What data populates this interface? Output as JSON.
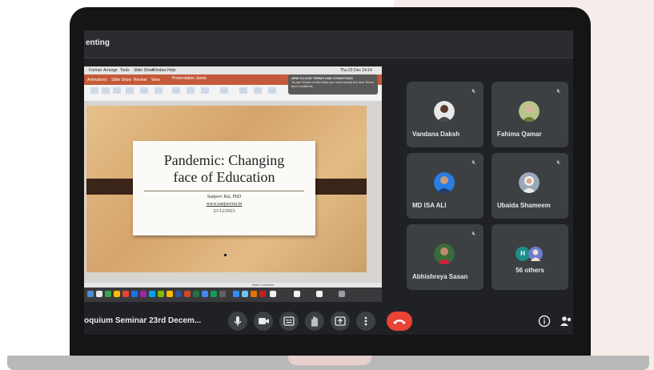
{
  "meet": {
    "top_title": "enting",
    "meeting_name": "oquium Seminar 23rd Decem...",
    "participants": [
      {
        "name": "Vandana Daksh"
      },
      {
        "name": "Fahima Qamar"
      },
      {
        "name": "MD ISA ALI"
      },
      {
        "name": "Ubaida Shameem"
      },
      {
        "name": "Abhishreya Sasan"
      }
    ],
    "others_label": "56 others",
    "others_chip": "H",
    "colors": {
      "end_call": "#ea4335",
      "tile": "#3c4043",
      "background": "#202124"
    },
    "icons": {
      "mic": "mic-icon",
      "camera": "camera-icon",
      "captions": "captions-icon",
      "hand": "raise-hand-icon",
      "present": "present-icon",
      "more": "more-vert-icon",
      "end": "end-call-icon",
      "info": "info-icon",
      "people": "people-icon",
      "muted": "mic-off-icon"
    }
  },
  "presentation": {
    "menu": [
      "Format",
      "Arrange",
      "Tools",
      "Slide Show",
      "Window",
      "Help"
    ],
    "clock": "Thu 23 Dec 14:14",
    "tabs": [
      "Animations",
      "Slide Show",
      "Review",
      "View"
    ],
    "doc_title": "Presentation Jamia",
    "notification": {
      "title": "NEW iCLOUD TERMS AND CONDITIONS",
      "body": "To use iCloud on this Mac you must accept the new Terms and Conditions."
    },
    "slide": {
      "title_line1": "Pandemic: Changing",
      "title_line2": "face of Education",
      "author": "Sanjeev Rai, PhD",
      "website": "www.sanjeevrai.in",
      "date": "23/12/2021"
    },
    "status": "Notes  Comments"
  }
}
